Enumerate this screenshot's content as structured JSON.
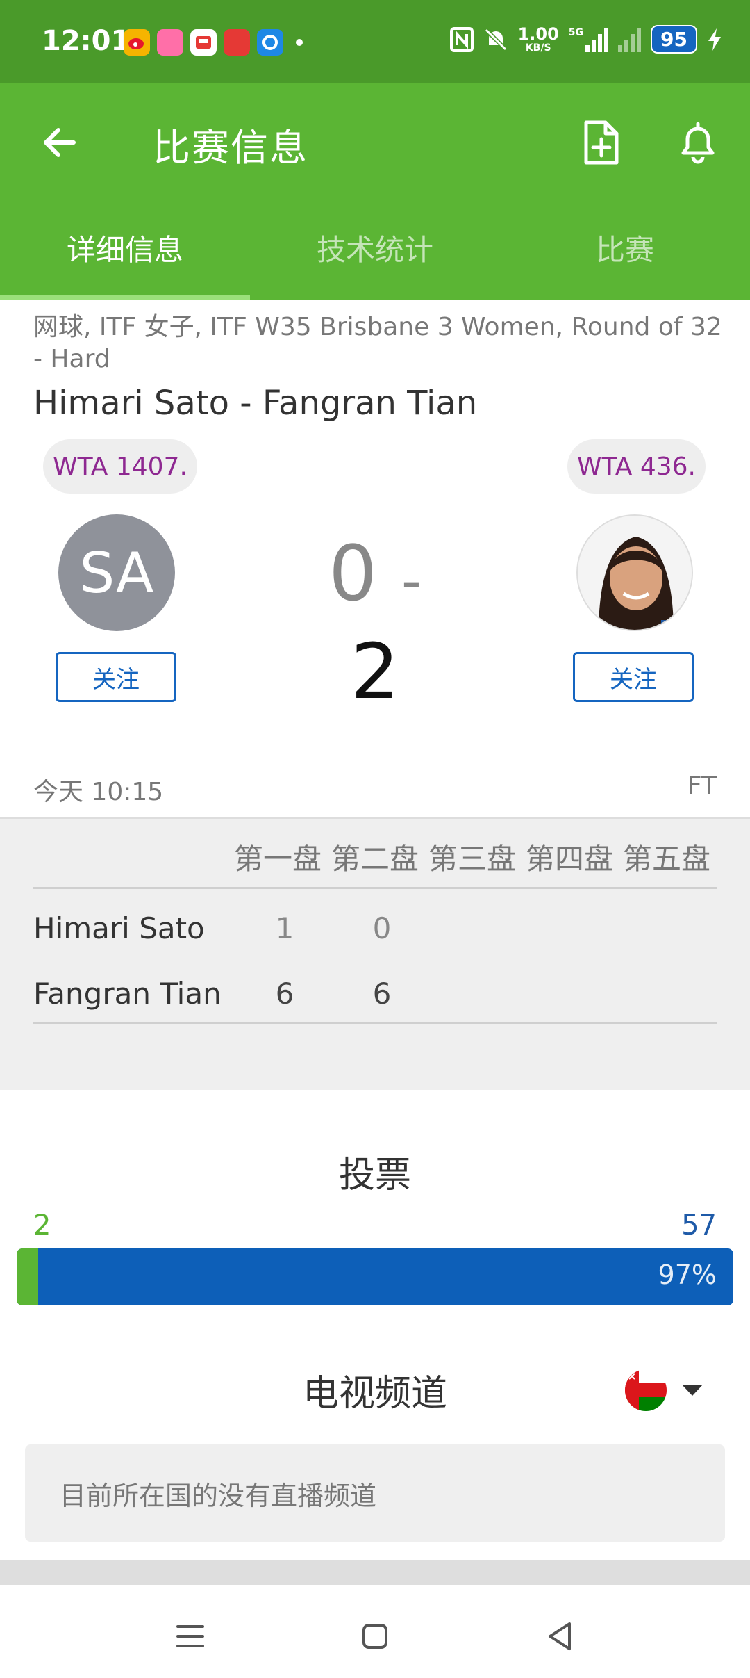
{
  "status": {
    "time": "12:01",
    "netspeed_value": "1.00",
    "netspeed_unit": "KB/S",
    "network": "5G",
    "battery": "95",
    "notification_icons": [
      "weibo-icon",
      "app-icon",
      "app-icon",
      "app-icon",
      "app-icon"
    ]
  },
  "app_bar": {
    "title": "比赛信息"
  },
  "tabs": [
    {
      "label": "详细信息",
      "active": true
    },
    {
      "label": "技术统计",
      "active": false
    },
    {
      "label": "比赛",
      "active": false
    }
  ],
  "match": {
    "meta": "网球, ITF 女子, ITF W35 Brisbane 3 Women, Round of 32 - Hard",
    "title": "Himari Sato - Fangran Tian",
    "home": {
      "rank": "WTA 1407.",
      "initials": "SA",
      "follow": "关注",
      "score": "0"
    },
    "away": {
      "rank": "WTA 436.",
      "follow": "关注",
      "score": "2"
    },
    "score_sep": "-",
    "date": "今天 10:15",
    "status": "FT"
  },
  "sets": {
    "headers": [
      "第一盘",
      "第二盘",
      "第三盘",
      "第四盘",
      "第五盘"
    ],
    "rows": [
      {
        "name": "Himari Sato",
        "scores": [
          "1",
          "0"
        ]
      },
      {
        "name": "Fangran Tian",
        "scores": [
          "6",
          "6"
        ]
      }
    ]
  },
  "vote": {
    "title": "投票",
    "home_count": "2",
    "away_count": "57",
    "away_percent_label": "97%",
    "home_fraction": 0.03
  },
  "tv": {
    "title": "电视频道",
    "message": "目前所在国的没有直播频道"
  },
  "colors": {
    "green": "#5bb534",
    "dark_green": "#4a9a2a",
    "blue": "#0d5fb8",
    "rank_purple": "#8e2891"
  }
}
